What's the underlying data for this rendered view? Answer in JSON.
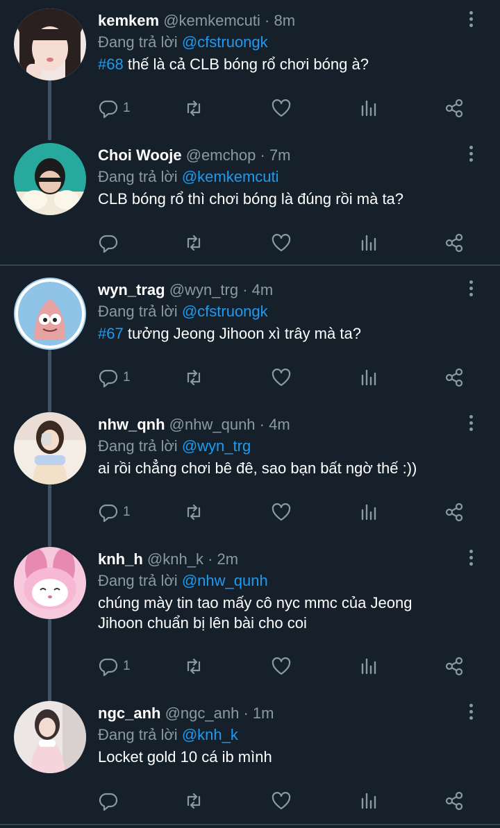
{
  "reply_prefix": "Đang trả lời",
  "tweets": [
    {
      "name": "kemkem",
      "handle": "@kemkemcuti",
      "time": "8m",
      "reply_to": "@cfstruongk",
      "hashtag": "#68",
      "text": " thế là cả CLB bóng rổ chơi bóng à?",
      "reply_count": "1",
      "avatar_colors": [
        "#f3d9d0",
        "#2b2020",
        "#e8b8b0"
      ]
    },
    {
      "name": "Choi Wooje",
      "handle": "@emchop",
      "time": "7m",
      "reply_to": "@kemkemcuti",
      "hashtag": "",
      "text": "CLB bóng rổ thì chơi bóng là đúng rồi mà ta?",
      "reply_count": "",
      "avatar_colors": [
        "#28a99e",
        "#1c1c1c",
        "#f1ead8"
      ]
    },
    {
      "name": "wyn_trag",
      "handle": "@wyn_trg",
      "time": "4m",
      "reply_to": "@cfstruongk",
      "hashtag": "#67",
      "text": " tưởng Jeong Jihoon xì trây mà ta?",
      "reply_count": "1",
      "avatar_colors": [
        "#8fc3e8",
        "#e7a2a2",
        "#ffffff"
      ]
    },
    {
      "name": "nhw_qnh",
      "handle": "@nhw_qunh",
      "time": "4m",
      "reply_to": "@wyn_trg",
      "hashtag": "",
      "text": "ai rồi chẳng chơi bê đê, sao bạn bất ngờ thế :))",
      "reply_count": "1",
      "avatar_colors": [
        "#f4ede6",
        "#3b2a22",
        "#f2e0c8"
      ]
    },
    {
      "name": "knh_h",
      "handle": "@knh_k",
      "time": "2m",
      "reply_to": "@nhw_qunh",
      "hashtag": "",
      "text": "chúng mày tin tao mấy cô nyc mmc của Jeong Jihoon chuẩn bị lên bài cho coi",
      "reply_count": "1",
      "avatar_colors": [
        "#f7b8d3",
        "#ffffff",
        "#e78ab0"
      ]
    },
    {
      "name": "ngc_anh",
      "handle": "@ngc_anh",
      "time": "1m",
      "reply_to": "@knh_k",
      "hashtag": "",
      "text": "Locket gold 10 cá ib mình",
      "reply_count": "",
      "avatar_colors": [
        "#ece6e4",
        "#3a2e2e",
        "#f6d4dc"
      ]
    }
  ]
}
